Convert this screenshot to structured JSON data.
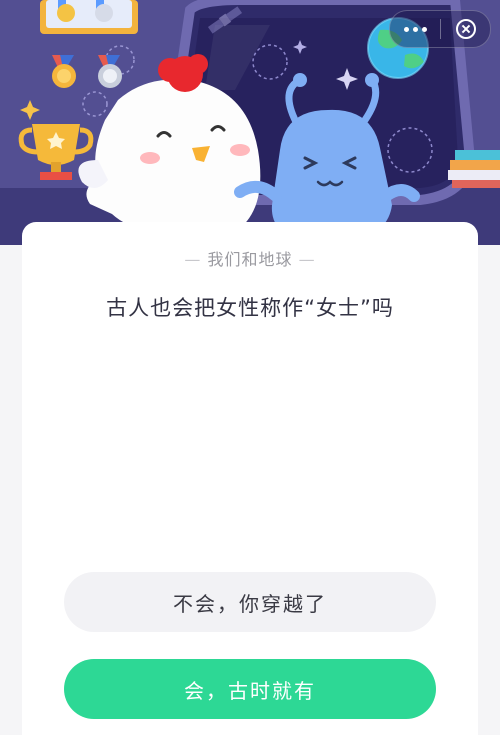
{
  "topbar": {
    "more_icon": "more-dots-icon",
    "close_icon": "close-circle-icon"
  },
  "colors": {
    "banner_bg": "#534f92",
    "accent_green": "#2dd895",
    "option_grey": "#f2f2f5",
    "text_dark": "#333344"
  },
  "quiz": {
    "category": "我们和地球",
    "question": "古人也会把女性称作“女士”吗",
    "options": [
      {
        "label": "不会，你穿越了"
      },
      {
        "label": "会，古时就有"
      }
    ]
  }
}
